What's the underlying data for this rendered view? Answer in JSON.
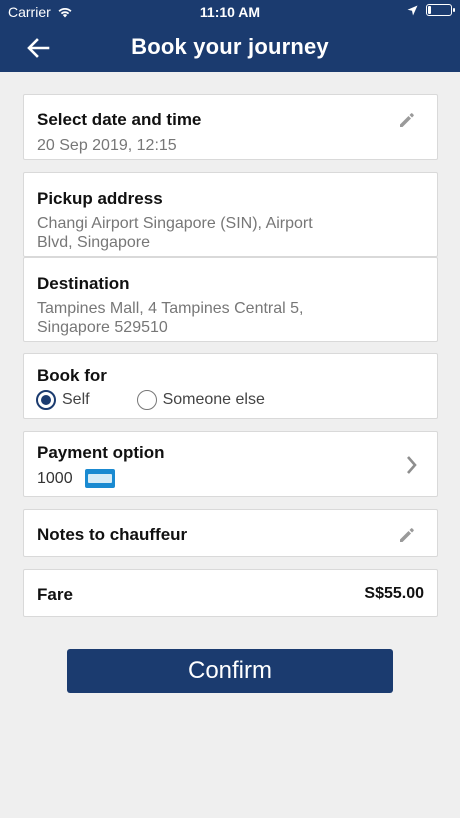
{
  "status_bar": {
    "carrier": "Carrier",
    "time": "11:10 AM",
    "battery_level": 0.15
  },
  "header": {
    "title": "Book your journey",
    "back_icon": "arrow-left-icon"
  },
  "date_time": {
    "label": "Select date and time",
    "value": "20 Sep 2019, 12:15",
    "edit_icon": "pencil-icon"
  },
  "pickup": {
    "label": "Pickup address",
    "line1": "Changi Airport Singapore (SIN), Airport",
    "line2": "Blvd, Singapore"
  },
  "destination": {
    "label": "Destination",
    "line1": "Tampines Mall, 4 Tampines Central 5,",
    "line2": "Singapore 529510"
  },
  "book_for": {
    "label": "Book for",
    "options": [
      {
        "label": "Self",
        "selected": true
      },
      {
        "label": "Someone else",
        "selected": false
      }
    ]
  },
  "payment": {
    "label": "Payment option",
    "value": "1000",
    "card_icon": "amex-card-icon"
  },
  "notes": {
    "label": "Notes to chauffeur",
    "edit_icon": "pencil-icon"
  },
  "fare": {
    "label": "Fare",
    "value": "S$55.00"
  },
  "confirm": {
    "label": "Confirm"
  },
  "colors": {
    "brand": "#1b3b6f",
    "background": "#efefef"
  }
}
